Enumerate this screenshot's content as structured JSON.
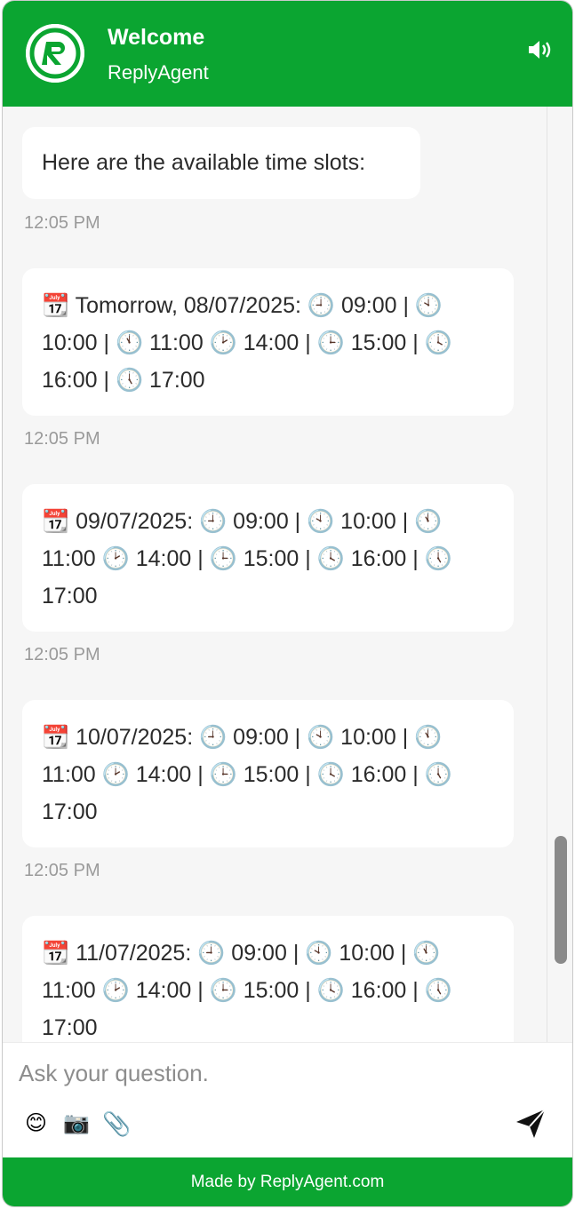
{
  "header": {
    "title": "Welcome",
    "subtitle": "ReplyAgent",
    "logo_icon": "replyagent-logo",
    "sound_icon": "speaker-icon",
    "brand_color": "#0BA531"
  },
  "messages": [
    {
      "text": "Here are the available time slots:",
      "time": "12:05 PM"
    },
    {
      "text": "📆 Tomorrow, 08/07/2025: 🕘 09:00 | 🕙 10:00 | 🕚 11:00 🕑 14:00 | 🕒 15:00 | 🕓 16:00 | 🕔 17:00",
      "time": "12:05 PM"
    },
    {
      "text": "📆 09/07/2025: 🕘 09:00 | 🕙 10:00 | 🕚 11:00 🕑 14:00 | 🕒 15:00 | 🕓 16:00 | 🕔 17:00",
      "time": "12:05 PM"
    },
    {
      "text": "📆 10/07/2025: 🕘 09:00 | 🕙 10:00 | 🕚 11:00 🕑 14:00 | 🕒 15:00 | 🕓 16:00 | 🕔 17:00",
      "time": "12:05 PM"
    },
    {
      "text": "📆 11/07/2025: 🕘 09:00 | 🕙 10:00 | 🕚 11:00 🕑 14:00 | 🕒 15:00 | 🕓 16:00 | 🕔 17:00"
    }
  ],
  "composer": {
    "placeholder": "Ask your question.",
    "emoji_icon": "😊",
    "camera_icon": "📷",
    "attach_icon": "📎",
    "send_icon": "send-icon"
  },
  "footer": {
    "text": "Made by ReplyAgent.com"
  }
}
